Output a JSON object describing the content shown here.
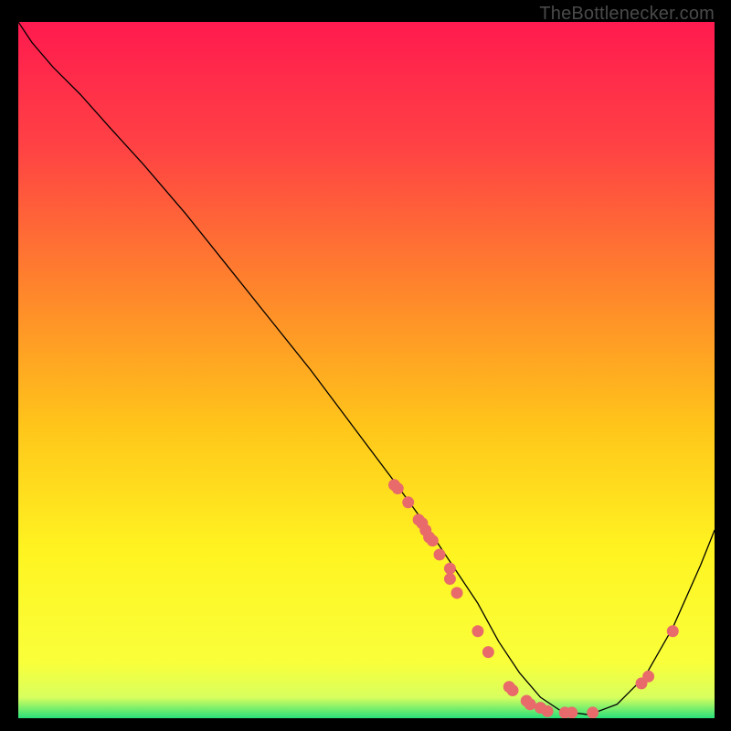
{
  "watermark": "TheBottlenecker.com",
  "colors": {
    "gradient_stops": [
      {
        "pct": 0,
        "color": "#ff1a4f"
      },
      {
        "pct": 18,
        "color": "#ff4244"
      },
      {
        "pct": 40,
        "color": "#ff8a2a"
      },
      {
        "pct": 58,
        "color": "#ffc51a"
      },
      {
        "pct": 76,
        "color": "#fff421"
      },
      {
        "pct": 92,
        "color": "#f9ff3a"
      },
      {
        "pct": 97,
        "color": "#d8ff5e"
      },
      {
        "pct": 100,
        "color": "#28e07a"
      }
    ],
    "green_band": "#28e07a",
    "dot": "#e86a6a",
    "curve": "#000000"
  },
  "chart_data": {
    "type": "line",
    "title": "",
    "xlabel": "",
    "ylabel": "",
    "xlim": [
      0,
      100
    ],
    "ylim": [
      0,
      100
    ],
    "series": [
      {
        "name": "bottleneck-curve",
        "x": [
          0,
          2,
          5,
          9,
          13,
          18,
          24,
          30,
          36,
          42,
          48,
          54,
          58,
          62,
          66,
          69,
          72,
          75,
          78,
          82,
          86,
          90,
          94,
          98,
          100
        ],
        "y": [
          100,
          97,
          93.5,
          89.5,
          85,
          79.5,
          72.5,
          65,
          57.5,
          50,
          42,
          34,
          28.5,
          22.5,
          16.5,
          11,
          6.5,
          3,
          1,
          0.5,
          2,
          6,
          13,
          22,
          27
        ]
      }
    ],
    "points": [
      {
        "x": 54.0,
        "y": 33.5
      },
      {
        "x": 54.5,
        "y": 33.0
      },
      {
        "x": 56.0,
        "y": 31.0
      },
      {
        "x": 57.5,
        "y": 28.5
      },
      {
        "x": 58.0,
        "y": 28.0
      },
      {
        "x": 58.5,
        "y": 27.0
      },
      {
        "x": 59.0,
        "y": 26.0
      },
      {
        "x": 59.5,
        "y": 25.5
      },
      {
        "x": 60.5,
        "y": 23.5
      },
      {
        "x": 62.0,
        "y": 21.5
      },
      {
        "x": 62.0,
        "y": 20.0
      },
      {
        "x": 63.0,
        "y": 18.0
      },
      {
        "x": 66.0,
        "y": 12.5
      },
      {
        "x": 67.5,
        "y": 9.5
      },
      {
        "x": 70.5,
        "y": 4.5
      },
      {
        "x": 71.0,
        "y": 4.0
      },
      {
        "x": 73.0,
        "y": 2.5
      },
      {
        "x": 73.5,
        "y": 2.0
      },
      {
        "x": 75.0,
        "y": 1.5
      },
      {
        "x": 76.0,
        "y": 1.0
      },
      {
        "x": 78.5,
        "y": 0.8
      },
      {
        "x": 79.5,
        "y": 0.8
      },
      {
        "x": 82.5,
        "y": 0.8
      },
      {
        "x": 89.5,
        "y": 5.0
      },
      {
        "x": 90.5,
        "y": 6.0
      },
      {
        "x": 94.0,
        "y": 12.5
      }
    ],
    "annotations": []
  }
}
